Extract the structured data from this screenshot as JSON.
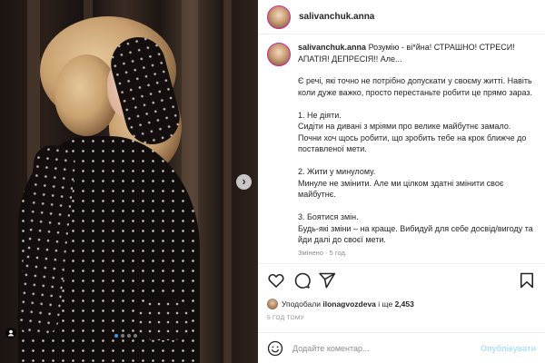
{
  "header": {
    "username": "salivanchuk.anna"
  },
  "caption": {
    "username": "salivanchuk.anna",
    "lead": "Розумію - ві*йна! СТРАШНО! СТРЕСИ!АПАТІЯ! ДЕПРЕСІЯ!! Але...",
    "body": "Є речі, які точно не потрібно допускати у своєму житті. Навіть коли дуже важко, просто перестаньте робити це прямо зараз.\n\n1. Не діяти.\nСидіти на дивані з мріями про велике майбутнє замало. Почни хоч щось робити, що зробить тебе на крок ближче до поставленої мети.\n\n2. Жити у минулому.\nМинуле не змінити. Але ми цілком здатні змінити своє майбутнє.\n\n3. Боятися змін.\nБудь-які зміни – на краще. Вибидуй для себе досвід/вигоду та йди далі до своєї мети.",
    "edited": "Змінено · 5 год."
  },
  "likes": {
    "prefix": "Уподобали",
    "user": "ilonagvozdeva",
    "middle": "і ще",
    "count": "2,453"
  },
  "timestamp": "5 ГОД ТОМУ",
  "comment": {
    "placeholder": "Додайте коментар...",
    "post_label": "Опублікувати"
  },
  "carousel": {
    "slides": 4,
    "active": 1
  },
  "colors": {
    "accent": "#3897f0",
    "post_disabled": "#b2dffc",
    "text": "#262626",
    "muted": "#8e8e8e"
  },
  "icons": [
    "user-tag-icon",
    "chevron-right-icon",
    "heart-icon",
    "comment-icon",
    "share-icon",
    "bookmark-icon",
    "smile-icon"
  ]
}
